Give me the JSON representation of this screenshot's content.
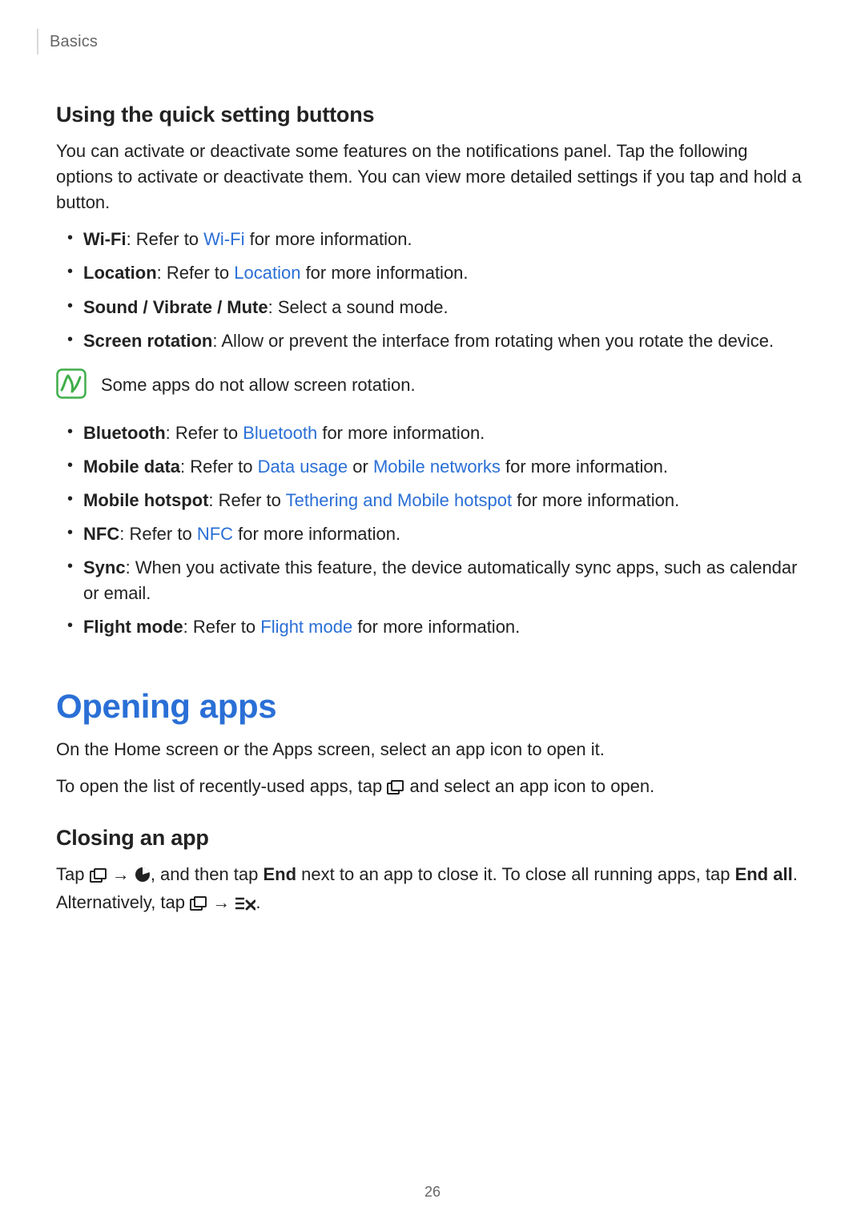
{
  "running_head": "Basics",
  "page_number": "26",
  "sec1": {
    "heading": "Using the quick setting buttons",
    "intro": "You can activate or deactivate some features on the notifications panel. Tap the following options to activate or deactivate them. You can view more detailed settings if you tap and hold a button.",
    "items1": {
      "wifi": {
        "term": "Wi-Fi",
        "pre": ": Refer to ",
        "link": "Wi-Fi",
        "post": " for more information."
      },
      "loc": {
        "term": "Location",
        "pre": ": Refer to ",
        "link": "Location",
        "post": " for more information."
      },
      "sound": {
        "term_full": "Sound / Vibrate / Mute",
        "rest": ": Select a sound mode."
      },
      "scrrot": {
        "term": "Screen rotation",
        "rest": ": Allow or prevent the interface from rotating when you rotate the device."
      }
    },
    "note": "Some apps do not allow screen rotation.",
    "items2": {
      "bt": {
        "term": "Bluetooth",
        "pre": ": Refer to ",
        "link": "Bluetooth",
        "post": " for more information."
      },
      "mdata": {
        "term": "Mobile data",
        "pre": ": Refer to ",
        "link1": "Data usage",
        "mid": " or ",
        "link2": "Mobile networks",
        "post": " for more information."
      },
      "mhot": {
        "term": "Mobile hotspot",
        "pre": ": Refer to ",
        "link": "Tethering and Mobile hotspot",
        "post": " for more information."
      },
      "nfc": {
        "term": "NFC",
        "pre": ": Refer to ",
        "link": "NFC",
        "post": " for more information."
      },
      "sync": {
        "term": "Sync",
        "rest": ": When you activate this feature, the device automatically sync apps, such as calendar or email."
      },
      "flight": {
        "term": "Flight mode",
        "pre": ": Refer to ",
        "link": "Flight mode",
        "post": " for more information."
      }
    }
  },
  "sec2": {
    "title": "Opening apps",
    "p1": "On the Home screen or the Apps screen, select an app icon to open it.",
    "p2_a": "To open the list of recently-used apps, tap ",
    "p2_b": " and select an app icon to open.",
    "closing_heading": "Closing an app",
    "close": {
      "a": "Tap ",
      "arrow1": " → ",
      "b": ", and then tap ",
      "end": "End",
      "c": " next to an app to close it. To close all running apps, tap ",
      "endall": "End all",
      "d": ". Alternatively, tap ",
      "arrow2": " → ",
      "e": "."
    }
  }
}
